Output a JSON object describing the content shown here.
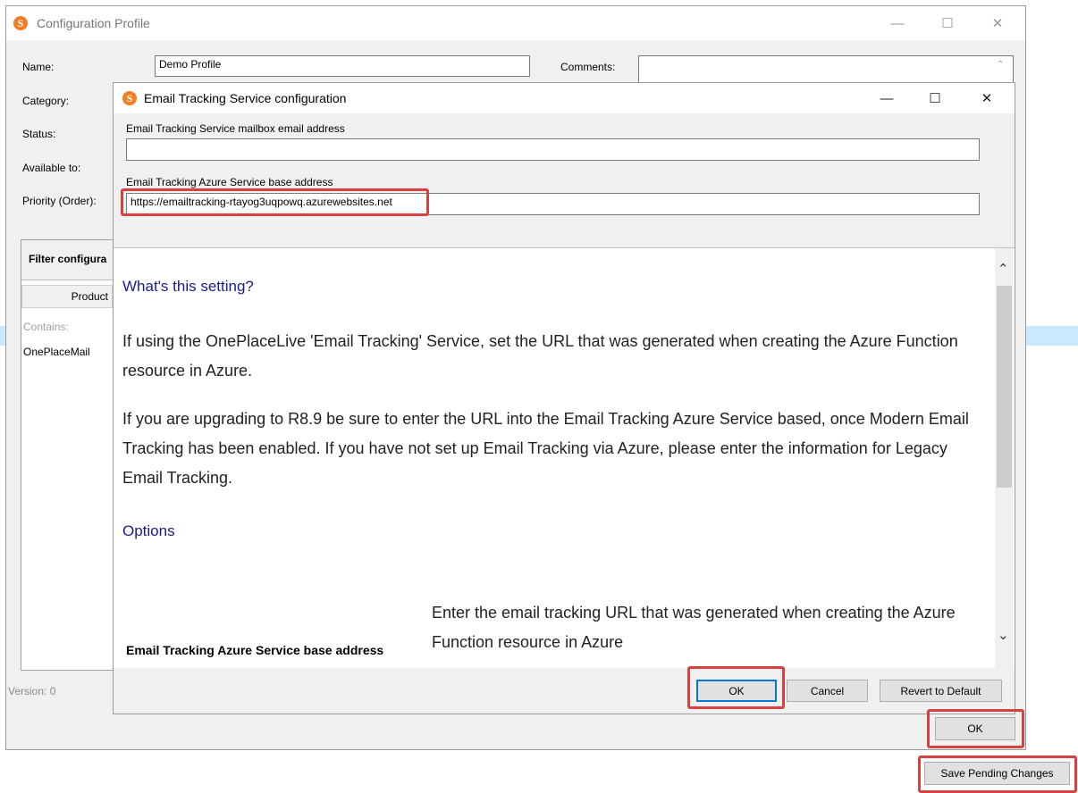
{
  "main_window": {
    "title": "Configuration Profile",
    "name_label": "Name:",
    "name_value": "Demo Profile",
    "comments_label": "Comments:",
    "category_label": "Category:",
    "status_label": "Status:",
    "available_label": "Available to:",
    "priority_label": "Priority (Order):",
    "filter_header": "Filter configura",
    "product_col": "Product",
    "contains_label": "Contains:",
    "row_value": "OnePlaceMail",
    "version_label": "Version:  0",
    "ok_label": "OK"
  },
  "save_button_label": "Save Pending Changes",
  "dialog": {
    "title": "Email Tracking Service configuration",
    "mailbox_label": "Email Tracking Service mailbox email address",
    "mailbox_value": "",
    "azure_label": "Email Tracking Azure Service base address",
    "azure_value": "https://emailtracking-rtayog3uqpowq.azurewebsites.net",
    "help": {
      "heading1": "What's this setting?",
      "para1": "If using the OnePlaceLive 'Email Tracking' Service, set the URL that was generated when creating the Azure Function resource in Azure.",
      "para2": "If you are upgrading to R8.9 be sure to enter the URL into the Email Tracking Azure Service based, once Modern Email Tracking has been enabled. If you have not set up Email Tracking via Azure, please enter the information for Legacy Email Tracking.",
      "heading2": "Options",
      "option_name": "Email Tracking Azure Service base address",
      "option_desc": "Enter the email tracking URL that was generated when creating the Azure Function resource in Azure"
    },
    "ok_label": "OK",
    "cancel_label": "Cancel",
    "revert_label": "Revert to Default"
  },
  "colors": {
    "highlight": "#d94040",
    "selection": "#cce8ff",
    "link_blue": "#1a1a8c"
  }
}
